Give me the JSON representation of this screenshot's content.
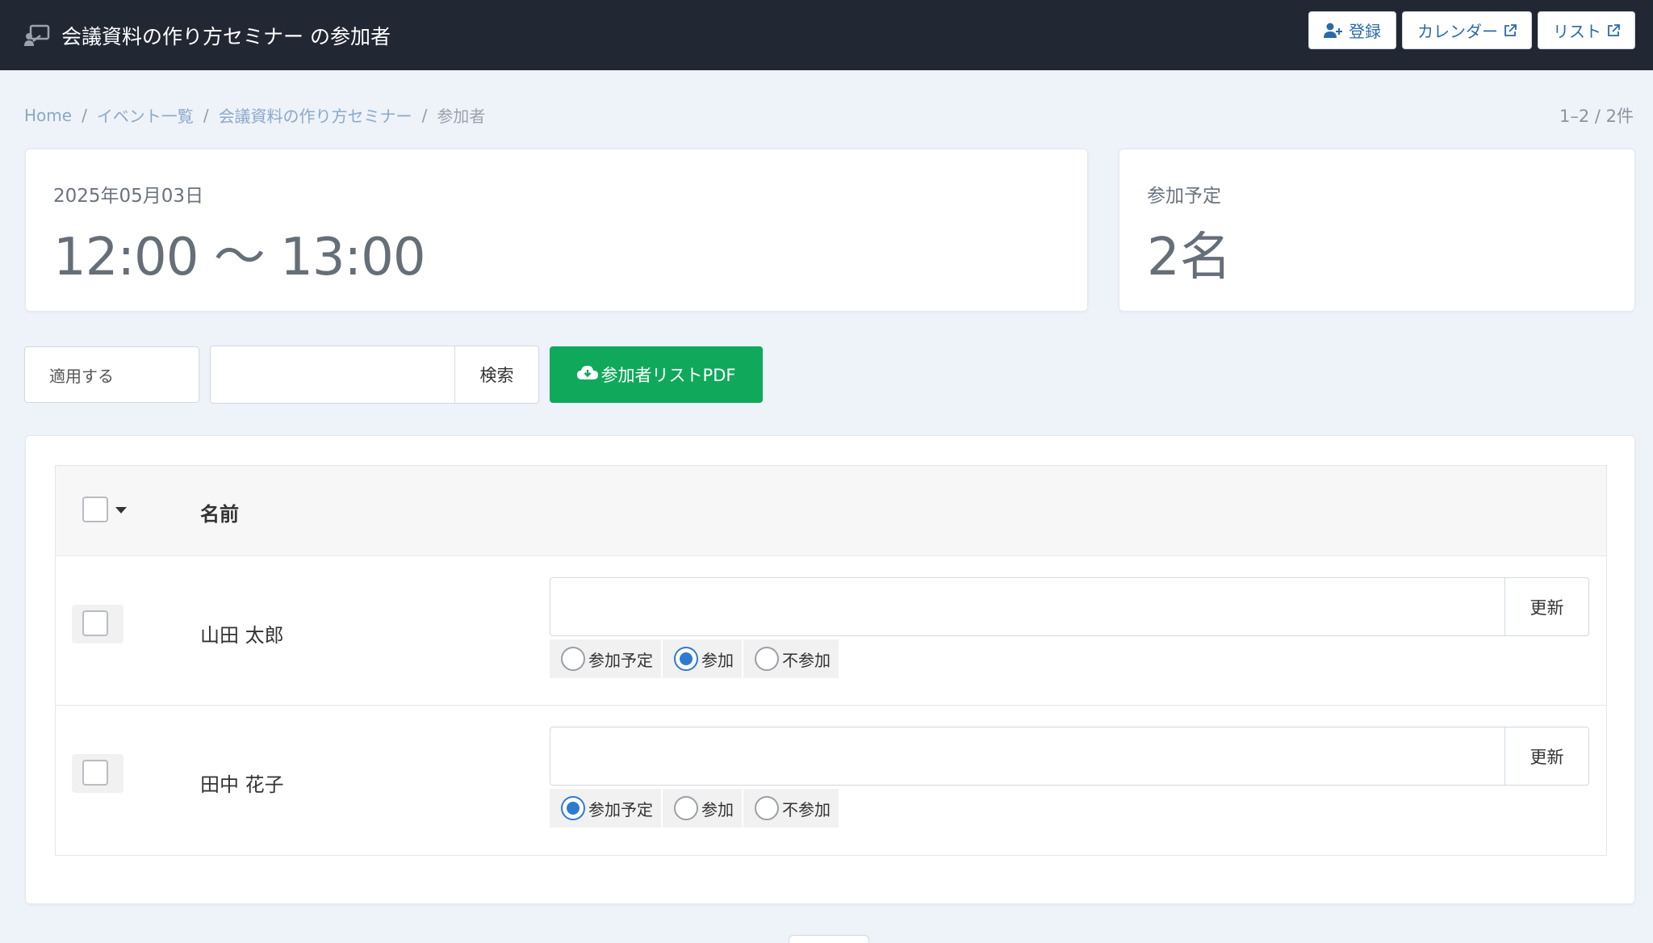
{
  "header": {
    "title": "会議資料の作り方セミナー の参加者",
    "buttons": {
      "register": "登録",
      "calendar": "カレンダー",
      "list": "リスト"
    }
  },
  "breadcrumb": {
    "home": "Home",
    "events": "イベント一覧",
    "event": "会議資料の作り方セミナー",
    "current": "参加者",
    "separator": "/"
  },
  "pagination": {
    "summary": "1–2 / 2件"
  },
  "event_info": {
    "date": "2025年05月03日",
    "time": "12:00 〜 13:00",
    "planned_label": "参加予定",
    "planned_count": "2名"
  },
  "toolbar": {
    "apply_label": "適用する",
    "search_value": "",
    "search_button": "検索",
    "pdf_button": "参加者リストPDF"
  },
  "table": {
    "columns": {
      "name": "名前"
    },
    "status_options": [
      "参加予定",
      "参加",
      "不参加"
    ],
    "update_label": "更新",
    "rows": [
      {
        "name": "山田 太郎",
        "note": "",
        "status": "参加"
      },
      {
        "name": "田中 花子",
        "note": "",
        "status": "参加予定"
      }
    ]
  },
  "colors": {
    "topbar": "#212733",
    "link": "#2a6aa8",
    "pdf_button": "#10a95b",
    "radio_selected": "#2f7ad1"
  }
}
